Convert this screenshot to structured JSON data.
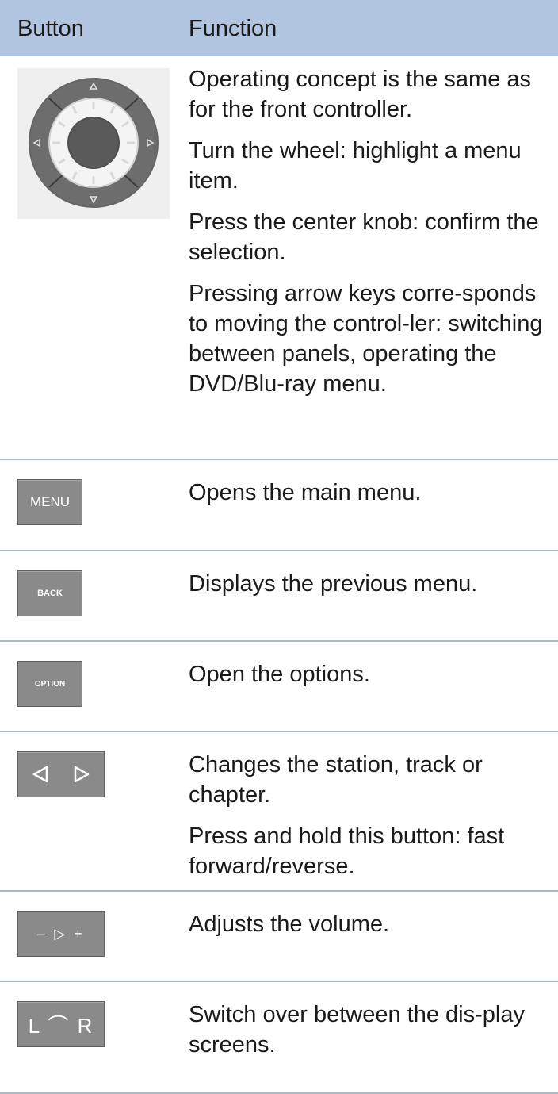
{
  "header": {
    "button": "Button",
    "function": "Function"
  },
  "rows": [
    {
      "paragraphs": [
        "Operating concept is the same as for the front controller.",
        "Turn the wheel: highlight a menu item.",
        "Press the center knob: confirm the selection.",
        "Pressing arrow keys corre-sponds to moving the control-ler: switching between panels, operating the DVD/Blu-ray menu."
      ]
    },
    {
      "key": "MENU",
      "paragraphs": [
        "Opens the main menu."
      ]
    },
    {
      "key": "BACK",
      "paragraphs": [
        "Displays the previous menu."
      ]
    },
    {
      "key": "OPTION",
      "paragraphs": [
        "Open the options."
      ]
    },
    {
      "paragraphs": [
        "Changes the station, track or chapter.",
        "Press and hold this button: fast forward/reverse."
      ]
    },
    {
      "key": "– ▷ +",
      "paragraphs": [
        "Adjusts the volume."
      ]
    },
    {
      "key": "L ⌒ R",
      "paragraphs": [
        "Switch over between the dis-play screens."
      ]
    }
  ],
  "icons": [
    "controller-icon",
    "menu-key-icon",
    "back-key-icon",
    "option-key-icon",
    "arrow-keys-icon",
    "volume-key-icon",
    "display-switch-icon"
  ]
}
